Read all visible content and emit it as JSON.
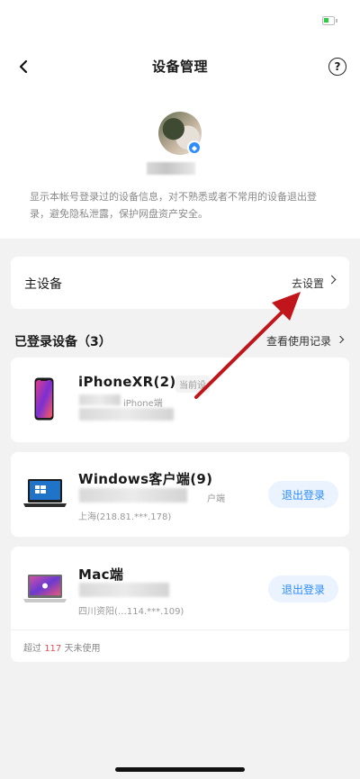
{
  "header": {
    "title": "设备管理",
    "help_label": "?"
  },
  "account": {
    "description": "显示本帐号登录过的设备信息，对不熟悉或者不常用的设备退出登录，避免隐私泄露，保护网盘资产安全。"
  },
  "primary_device": {
    "label": "主设备",
    "action": "去设置"
  },
  "devices_section": {
    "title": "已登录设备（3）",
    "history_link": "查看使用记录"
  },
  "devices": [
    {
      "name": "iPhoneXR(2)",
      "badge": "当前设",
      "sub": "iPhone端",
      "icon": "iphone-icon"
    },
    {
      "name": "Windows客户端(9)",
      "sub_suffix": "户端",
      "location": "上海(218.81.***.178)",
      "logout": "退出登录",
      "icon": "laptop-windows-icon"
    },
    {
      "name": "Mac端",
      "location": "四川资阳(…114.***.109)",
      "logout": "退出登录",
      "unused_prefix": "超过 ",
      "unused_days": "117",
      "unused_suffix": " 天未使用",
      "icon": "macbook-icon"
    }
  ],
  "colors": {
    "accent": "#2f8cff",
    "warning": "#e0505a",
    "arrow": "#c0151a"
  }
}
